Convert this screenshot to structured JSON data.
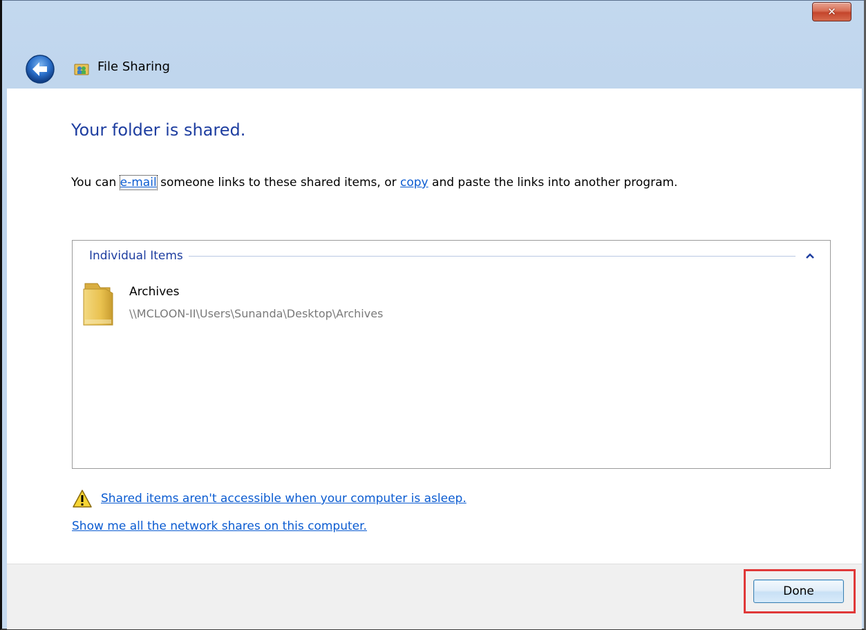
{
  "window": {
    "title": "File Sharing",
    "close_label": "✕"
  },
  "main": {
    "heading": "Your folder is shared.",
    "desc_prefix": "You can ",
    "email_link": "e-mail",
    "desc_middle": " someone links to these shared items, or ",
    "copy_link": "copy",
    "desc_suffix": " and paste the links into another program."
  },
  "items_group": {
    "label": "Individual Items",
    "items": [
      {
        "name": "Archives",
        "path": "\\\\MCLOON-II\\Users\\Sunanda\\Desktop\\Archives"
      }
    ]
  },
  "links": {
    "asleep_warning": "Shared items aren't accessible when your computer is asleep.",
    "show_shares": "Show me all the network shares on this computer."
  },
  "footer": {
    "done_label": "Done",
    "highlight_color": "#e03838"
  },
  "icons": {
    "back": "back-arrow-icon",
    "title": "file-sharing-icon",
    "folder": "folder-icon",
    "warning": "warning-icon",
    "chevron": "chevron-up-icon"
  }
}
